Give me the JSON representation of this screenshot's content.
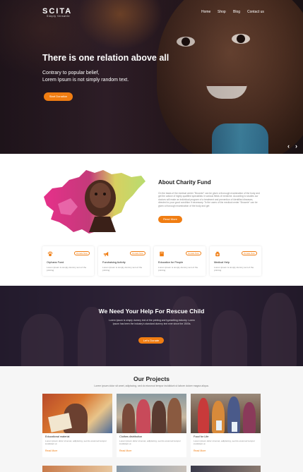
{
  "brand": {
    "name": "SCITA",
    "tagline": "Simply Versatile"
  },
  "nav": {
    "items": [
      "Home",
      "Shop",
      "Blog",
      "Contact us"
    ]
  },
  "hero": {
    "title": "There is one relation above all",
    "subtitle_line1": "Contrary to popular belief,",
    "subtitle_line2": "Lorem Ipsum is not simply random text.",
    "button": "Start Donation",
    "prev_icon": "chevron-left-icon",
    "next_icon": "chevron-right-icon"
  },
  "about": {
    "title": "About Charity Fund",
    "text": "On the basis of the medical center \"Brownie\" can be given a thorough examination of the body and get the advice of highly qualified specialists in various fields of medicine. According to studies our doctors will make an individual program of a treatment and prevention of identified diseases, directed to your good condition if necessary. To the users of the medical center \"Brownie\" can be given a thorough examination of the body and get",
    "button": "Read More"
  },
  "features": [
    {
      "icon": "paw-icon",
      "title": "Orphans Fund",
      "desc": "Lorem Ipsum is simply dummy text of the printing.",
      "button": "Donate Now"
    },
    {
      "icon": "megaphone-icon",
      "title": "Fundraising Activity",
      "desc": "Lorem Ipsum is simply dummy text of the printing.",
      "button": "Donate Now"
    },
    {
      "icon": "book-icon",
      "title": "Education for People",
      "desc": "Lorem Ipsum is simply dummy text of the printing.",
      "button": "Donate Now"
    },
    {
      "icon": "medical-icon",
      "title": "Medical Help",
      "desc": "Lorem Ipsum is simply dummy text of the printing.",
      "button": "Donate Now"
    }
  ],
  "rescue": {
    "title": "We Need Your Help For Rescue Child",
    "desc": "Lorem Ipsum is simply dummy text of the printing and typesetting industry. Lorem Ipsum has been the industry's standard dummy text ever since the 1500s.",
    "button": "Let's Donate"
  },
  "projects": {
    "title": "Our Projects",
    "subtitle": "Lorem ipsum dolor sit amet, adipiscing, sed do eiusmod tempor incididunt ut labore dolore magna aliqua.",
    "items": [
      {
        "title": "Educational material",
        "desc": "Lorem ipsum dolor sit amet, adipiscing, sed do eiusmod tempor incididunt ut",
        "link": "Read More"
      },
      {
        "title": "Clothes distribution",
        "desc": "Lorem ipsum dolor sit amet, adipiscing, sed do eiusmod tempor incididunt ut",
        "link": "Read More"
      },
      {
        "title": "Food for Life",
        "desc": "Lorem ipsum dolor sit amet, adipiscing, sed do eiusmod tempor incididunt ut",
        "link": "Read More"
      }
    ]
  },
  "colors": {
    "accent": "#f07d12",
    "dark_overlay": "#2c2536",
    "projects_bg": "#f6f6f6"
  }
}
